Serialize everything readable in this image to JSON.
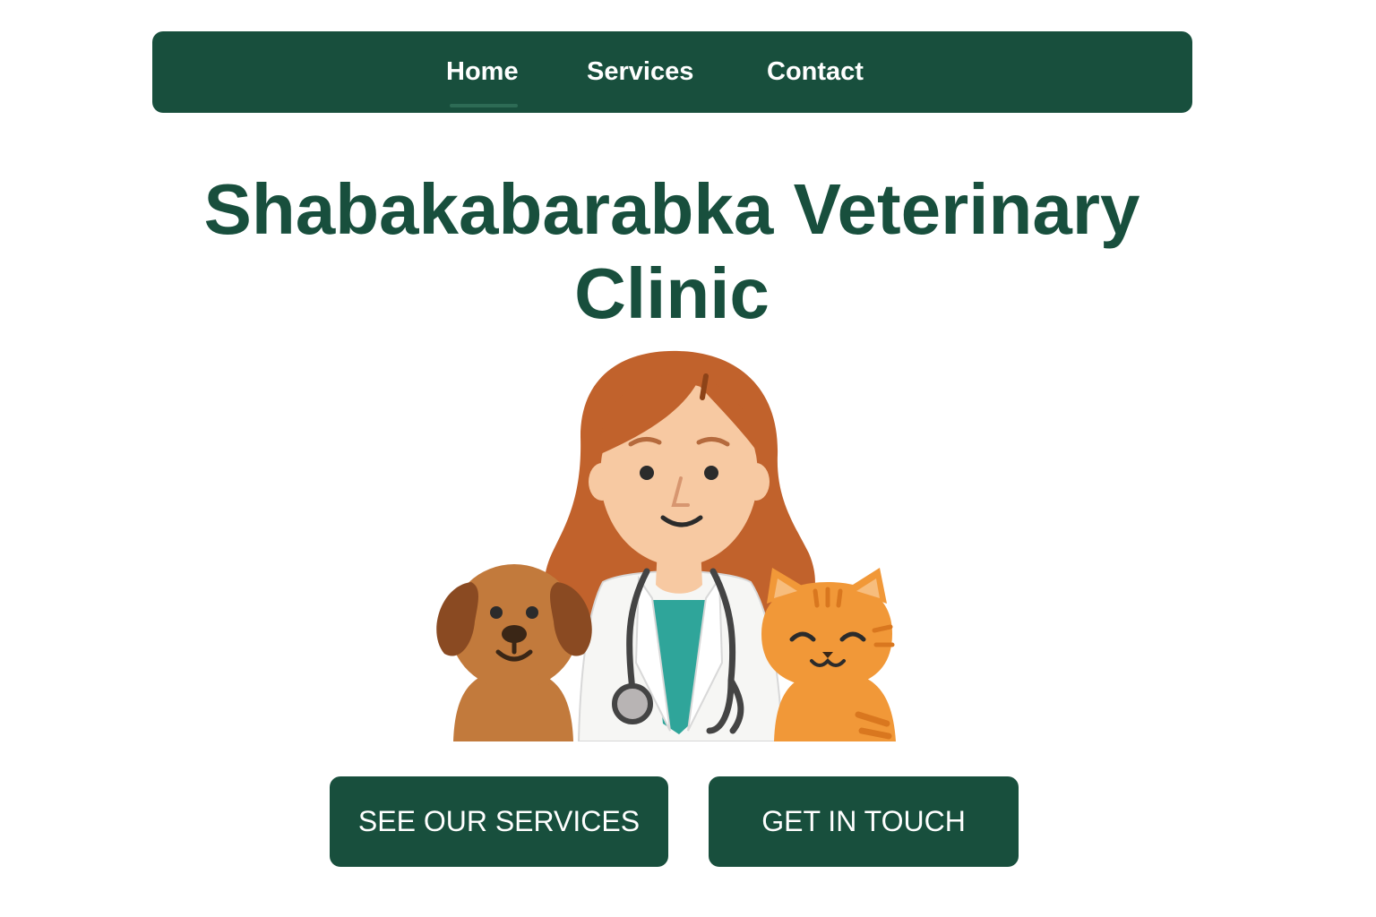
{
  "nav": {
    "items": [
      {
        "label": "Home",
        "active": true
      },
      {
        "label": "Services"
      },
      {
        "label": "Contact"
      }
    ]
  },
  "hero": {
    "title": "Shabakabarabka Veterinary Clinic",
    "illustration": "veterinarian-with-dog-and-cat"
  },
  "buttons": {
    "services_label": "SEE OUR SERVICES",
    "contact_label": "GET IN TOUCH"
  },
  "colors": {
    "primary": "#184f3d",
    "button_text": "#ffffff",
    "page_background": "#ffffff"
  }
}
